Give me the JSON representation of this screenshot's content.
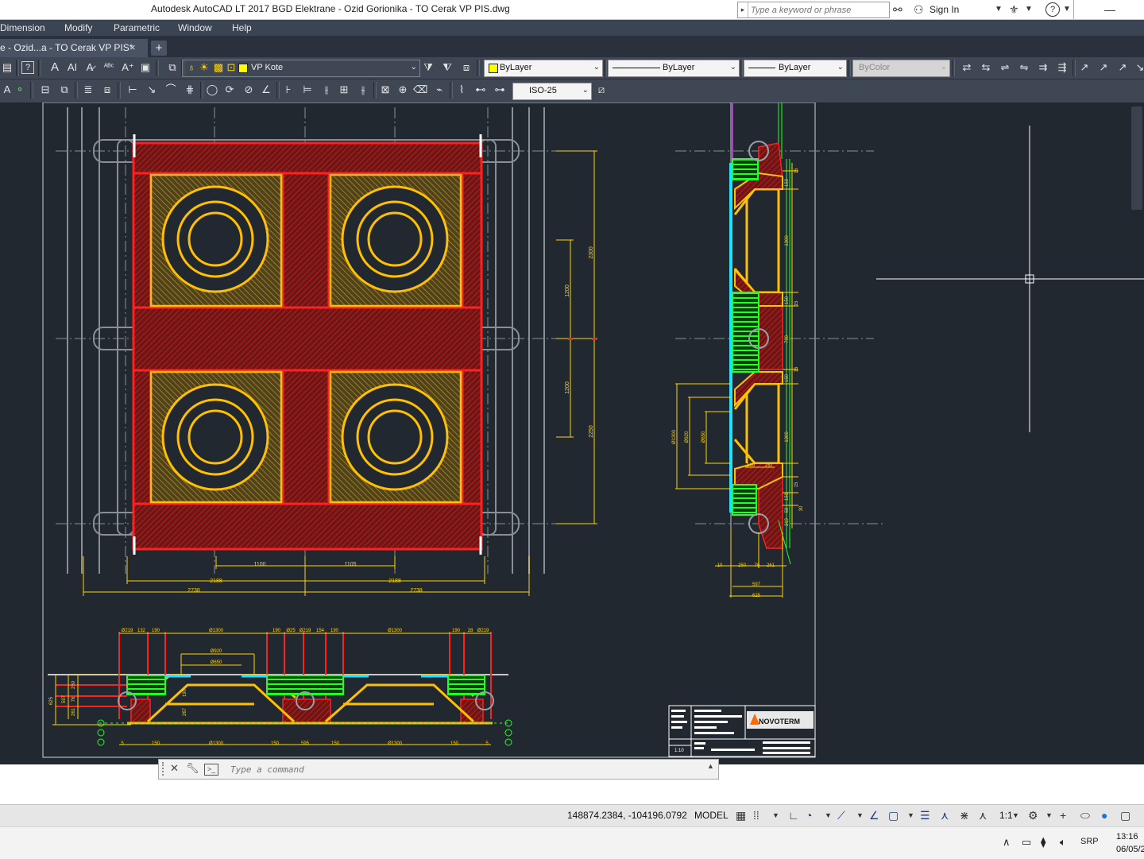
{
  "window": {
    "title": "Autodesk AutoCAD LT 2017    BGD Elektrane - Ozid Gorionika - TO Cerak VP PIS.dwg",
    "search_placeholder": "Type a keyword or phrase",
    "sign_in": "Sign In",
    "help": "?"
  },
  "menu": {
    "items": [
      "Dimension",
      "Modify",
      "Parametric",
      "Window",
      "Help"
    ]
  },
  "tabs": {
    "active_tab": "e - Ozid...a - TO Cerak VP PIS*",
    "close": "×",
    "add": "+"
  },
  "toolbar1": {
    "layer": "VP Kote",
    "color": "ByLayer",
    "linetype": "ByLayer",
    "lineweight": "ByLayer",
    "plotstyle": "ByColor",
    "colors": {
      "layer_swatch": "#ffff00"
    }
  },
  "toolbar2": {
    "dimstyle": "ISO-25"
  },
  "drawing": {
    "plan_dims": {
      "d2300": "2300",
      "d1200a": "1200",
      "d1200b": "1200",
      "d2250": "2250",
      "d1100": "1100",
      "d1105": "1105",
      "d2188a": "2188",
      "d2188b": "2188",
      "d2738a": "2738",
      "d2738b": "2738"
    },
    "side_dims": {
      "s15a": "15",
      "s150a": "150",
      "s1300a": "1300",
      "s150b": "150",
      "s15b": "15",
      "s790": "790",
      "s15c": "15",
      "s150c": "150",
      "s1300b": "1300",
      "s150d": "150",
      "s15d": "15",
      "s219": "219",
      "s58": "58",
      "s30": "30",
      "phi1300": "Ø1300",
      "phi920": "Ø920",
      "phi650": "Ø650",
      "s190": "190",
      "s267": "267",
      "b10": "10",
      "b250": "250",
      "b76": "76",
      "b261": "261",
      "b597": "597",
      "b625": "625"
    },
    "section_dims": {
      "top": [
        "Ø219",
        "132",
        "190",
        "Ø1300",
        "190",
        "Ø25",
        "Ø219",
        "154",
        "190",
        "Ø1300",
        "190",
        "28",
        "Ø219"
      ],
      "phi920": "Ø920",
      "phi650": "Ø650",
      "left": [
        "625",
        "597",
        "250",
        "76",
        "261"
      ],
      "bottom": [
        "5",
        "150",
        "Ø1300",
        "150",
        "595",
        "150",
        "Ø1300",
        "150",
        "5"
      ],
      "s190": "190",
      "s267": "267"
    },
    "titleblock": {
      "logo": "NOVOTERM",
      "scale": "1:10"
    },
    "colors": {
      "bg": "#212830",
      "red": "#ff2020",
      "yellow": "#ffc000",
      "green": "#22ff22",
      "cyan": "#22e0ff",
      "white": "#ffffff"
    }
  },
  "command": {
    "placeholder": "Type a command"
  },
  "statusbar": {
    "coords": "148874.2384, -104196.0792",
    "model": "MODEL",
    "scale": "1:1"
  },
  "taskbar": {
    "lang": "SRP",
    "time": "13:16",
    "date": "06/05/20"
  }
}
